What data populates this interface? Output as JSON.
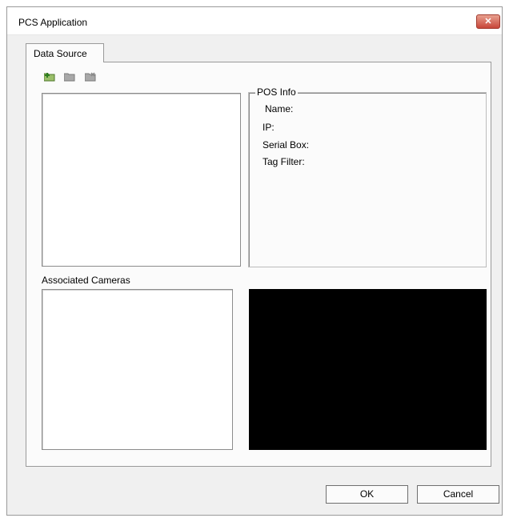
{
  "window": {
    "title": "PCS Application",
    "close_glyph": "✕"
  },
  "tabs": [
    {
      "label": "Data Source"
    }
  ],
  "toolbar": {
    "icons": [
      "add-icon",
      "edit-icon",
      "delete-icon"
    ]
  },
  "pos_info": {
    "legend": "POS Info",
    "fields": [
      {
        "label": "Name:"
      },
      {
        "label": "IP:"
      },
      {
        "label": "Serial Box:"
      },
      {
        "label": "Tag Filter:"
      }
    ]
  },
  "associated_cameras": {
    "label": "Associated Cameras"
  },
  "buttons": {
    "ok": "OK",
    "cancel": "Cancel"
  }
}
